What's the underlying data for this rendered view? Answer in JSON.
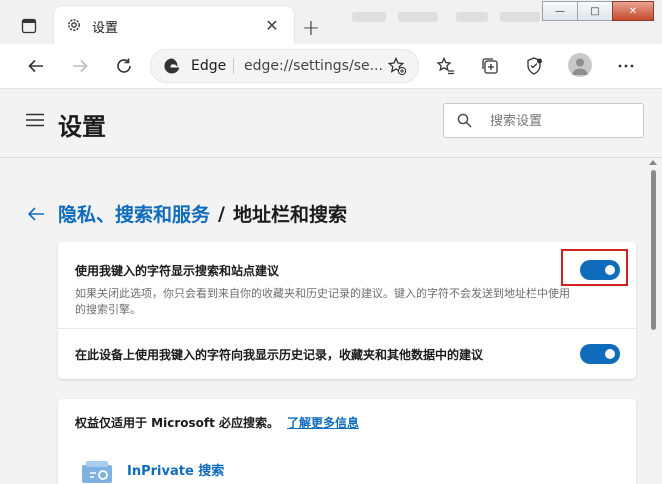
{
  "tab": {
    "title": "设置",
    "close": "✕",
    "new_tab": "+"
  },
  "window_controls": {
    "minimize": "—",
    "maximize": "□",
    "close": "✕"
  },
  "address_bar": {
    "site_label": "Edge",
    "url": "edge://settings/se..."
  },
  "settings": {
    "title": "设置",
    "search_placeholder": "搜索设置"
  },
  "breadcrumb": {
    "parent": "隐私、搜索和服务",
    "separator": "/",
    "current": "地址栏和搜索"
  },
  "suggestions_card": {
    "row1": {
      "title": "使用我键入的字符显示搜索和站点建议",
      "description": "如果关闭此选项，你只会看到来自你的收藏夹和历史记录的建议。键入的字符不会发送到地址栏中使用的搜索引擎。",
      "enabled": true
    },
    "row2": {
      "title": "在此设备上使用我键入的字符向我显示历史记录，收藏夹和其他数据中的建议",
      "enabled": true
    }
  },
  "microsoft_card": {
    "text": "权益仅适用于 Microsoft 必应搜索。",
    "link": "了解更多信息",
    "inprivate_label": "InPrivate 搜索"
  },
  "colors": {
    "accent": "#0f6cbd",
    "highlight": "#d32020"
  }
}
